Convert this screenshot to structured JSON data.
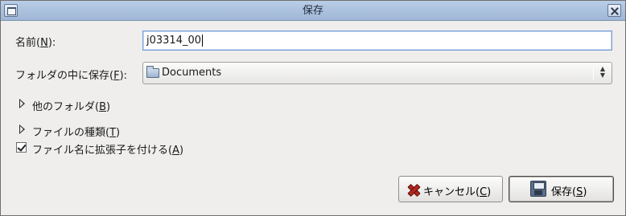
{
  "window": {
    "title": "保存"
  },
  "name_field": {
    "label_prefix": "名前(",
    "mnemonic": "N",
    "label_suffix": "):",
    "value": "j03314_00"
  },
  "folder_field": {
    "label_prefix": "フォルダの中に保存(",
    "mnemonic": "F",
    "label_suffix": "):",
    "selected": "Documents",
    "icon": "folder-icon"
  },
  "expanders": {
    "other_folders": {
      "prefix": "他のフォルダ(",
      "mnemonic": "B",
      "suffix": ")"
    },
    "file_type": {
      "prefix": "ファイルの種類(",
      "mnemonic": "T",
      "suffix": ")"
    }
  },
  "extension_option": {
    "prefix": "ファイル名に拡張子を付ける(",
    "mnemonic": "A",
    "suffix": ")",
    "checked": true
  },
  "buttons": {
    "cancel": {
      "prefix": "キャンセル(",
      "mnemonic": "C",
      "suffix": ")",
      "icon": "cancel-x-icon"
    },
    "save": {
      "prefix": "保存(",
      "mnemonic": "S",
      "suffix": ")",
      "icon": "floppy-disk-icon"
    }
  },
  "colors": {
    "titlebar": "#b9cde6",
    "window_bg": "#efeeed",
    "focus_border": "#7a9cd3"
  }
}
